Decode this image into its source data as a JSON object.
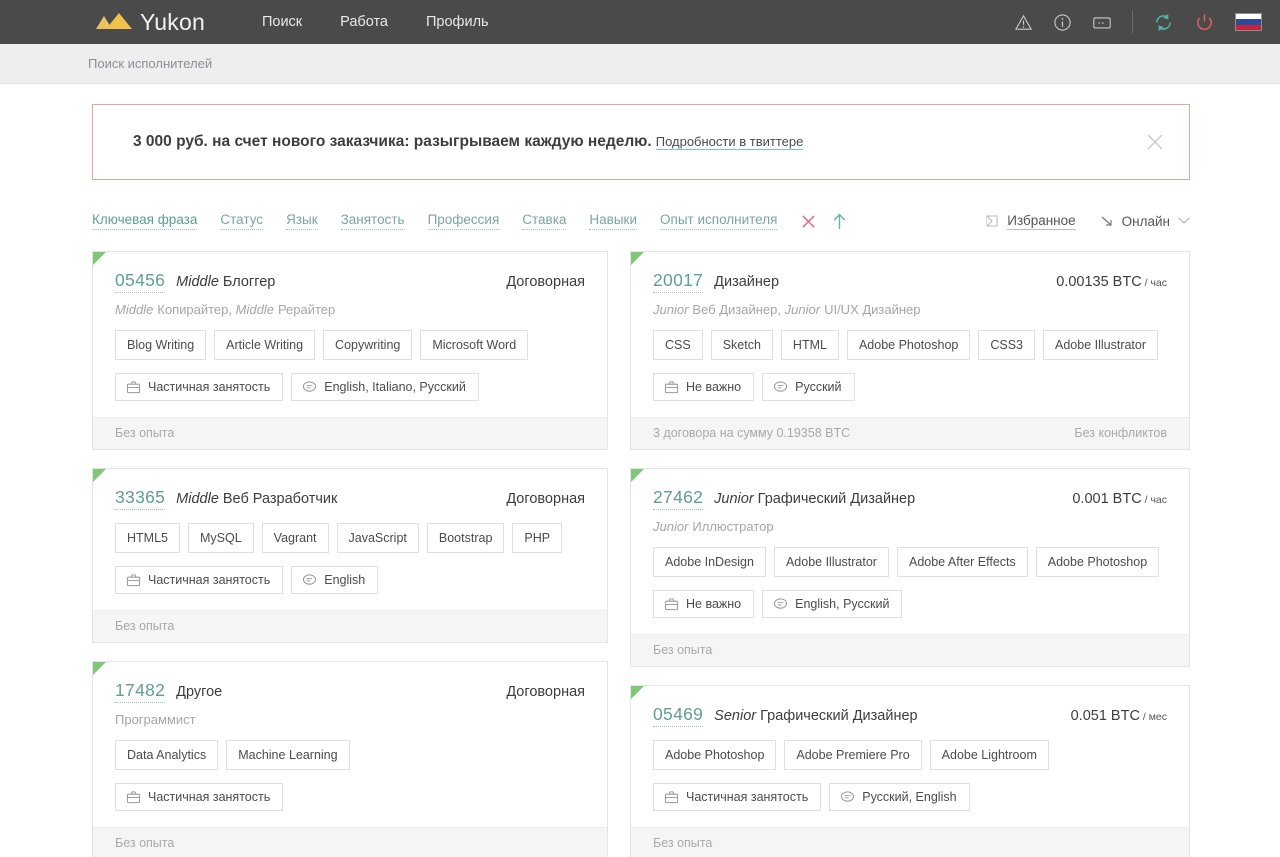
{
  "header": {
    "brand": "Yukon",
    "nav": [
      {
        "label": "Поиск"
      },
      {
        "label": "Работа"
      },
      {
        "label": "Профиль"
      }
    ],
    "icons": [
      "warning-icon",
      "info-icon",
      "message-icon",
      "refresh-icon",
      "power-icon"
    ],
    "language_flag": "russian-flag",
    "colors": {
      "bar": "#4a4a4a",
      "refresh": "#4fb3a5",
      "power": "#d9635e",
      "logo": "#f0c14b"
    }
  },
  "breadcrumb": {
    "text": "Поиск исполнителей"
  },
  "promo": {
    "text": "3 000 руб. на счет нового заказчика: разыгрываем каждую неделю.",
    "link": "Подробности в твиттере",
    "close_icon": "close-icon",
    "border_color": "#e0a899"
  },
  "filters": {
    "items": [
      {
        "label": "Ключевая фраза",
        "active": true
      },
      {
        "label": "Статус",
        "active": false
      },
      {
        "label": "Язык",
        "active": false
      },
      {
        "label": "Занятость",
        "active": false
      },
      {
        "label": "Профессия",
        "active": false
      },
      {
        "label": "Ставка",
        "active": false
      },
      {
        "label": "Навыки",
        "active": false
      },
      {
        "label": "Опыт исполнителя",
        "active": false
      }
    ],
    "clear_icon": "close-icon",
    "sort_icon": "arrow-up-icon",
    "favorites_label": "Избранное",
    "favorites_icon": "bookmark-icon",
    "online_label": "Онлайн",
    "online_icon": "arrow-down-right-icon",
    "online_caret": "chevron-down-icon",
    "clear_color": "#d9697b",
    "sort_color": "#6ab5aa"
  },
  "cards_left": [
    {
      "id": "05456",
      "grade": "Middle",
      "title": "Блоггер",
      "rate": "Договорная",
      "rate_unit": "",
      "subtitle_parts": [
        {
          "grade": "Middle",
          "text": "Копирайтер,"
        },
        {
          "grade": "Middle",
          "text": "Рерайтер"
        }
      ],
      "skills": [
        "Blog Writing",
        "Article Writing",
        "Copywriting",
        "Microsoft Word"
      ],
      "employment": "Частичная занятость",
      "languages": "English, Italiano, Русский",
      "footer_left": "Без опыта",
      "footer_right": ""
    },
    {
      "id": "33365",
      "grade": "Middle",
      "title": "Веб Разработчик",
      "rate": "Договорная",
      "rate_unit": "",
      "subtitle_parts": [],
      "skills": [
        "HTML5",
        "MySQL",
        "Vagrant",
        "JavaScript",
        "Bootstrap",
        "PHP"
      ],
      "employment": "Частичная занятость",
      "languages": "English",
      "footer_left": "Без опыта",
      "footer_right": ""
    },
    {
      "id": "17482",
      "grade": "",
      "title": "Другое",
      "rate": "Договорная",
      "rate_unit": "",
      "subtitle_parts": [
        {
          "grade": "",
          "text": "Программист"
        }
      ],
      "skills": [
        "Data Analytics",
        "Machine Learning"
      ],
      "employment": "Частичная занятость",
      "languages": "",
      "footer_left": "Без опыта",
      "footer_right": ""
    }
  ],
  "cards_right": [
    {
      "id": "20017",
      "grade": "",
      "title": "Дизайнер",
      "rate": "0.00135 BTC",
      "rate_unit": "/ час",
      "subtitle_parts": [
        {
          "grade": "Junior",
          "text": "Веб Дизайнер,"
        },
        {
          "grade": "Junior",
          "text": "UI/UX Дизайнер"
        }
      ],
      "skills": [
        "CSS",
        "Sketch",
        "HTML",
        "Adobe Photoshop",
        "CSS3",
        "Adobe Illustrator"
      ],
      "employment": "Не важно",
      "languages": "Русский",
      "footer_left": "3 договора на сумму 0.19358 BTC",
      "footer_right": "Без конфликтов"
    },
    {
      "id": "27462",
      "grade": "Junior",
      "title": "Графический Дизайнер",
      "rate": "0.001 BTC",
      "rate_unit": "/ час",
      "subtitle_parts": [
        {
          "grade": "Junior",
          "text": "Иллюстратор"
        }
      ],
      "skills": [
        "Adobe InDesign",
        "Adobe Illustrator",
        "Adobe After Effects",
        "Adobe Photoshop"
      ],
      "employment": "Не важно",
      "languages": "English, Русский",
      "footer_left": "Без опыта",
      "footer_right": ""
    },
    {
      "id": "05469",
      "grade": "Senior",
      "title": "Графический Дизайнер",
      "rate": "0.051 BTC",
      "rate_unit": "/ мес",
      "subtitle_parts": [],
      "skills": [
        "Adobe Photoshop",
        "Adobe Premiere Pro",
        "Adobe Lightroom"
      ],
      "employment": "Частичная занятость",
      "languages": "Русский, English",
      "footer_left": "Без опыта",
      "footer_right": ""
    }
  ]
}
